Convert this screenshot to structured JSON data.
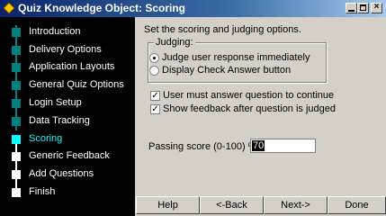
{
  "window": {
    "title": "Quiz Knowledge Object: Scoring"
  },
  "sidebar": {
    "items": [
      {
        "label": "Introduction",
        "state": "done"
      },
      {
        "label": "Delivery Options",
        "state": "done"
      },
      {
        "label": "Application Layouts",
        "state": "done"
      },
      {
        "label": "General Quiz Options",
        "state": "done"
      },
      {
        "label": "Login Setup",
        "state": "done"
      },
      {
        "label": "Data Tracking",
        "state": "done"
      },
      {
        "label": "Scoring",
        "state": "current"
      },
      {
        "label": "Generic Feedback",
        "state": "todo"
      },
      {
        "label": "Add Questions",
        "state": "todo"
      },
      {
        "label": "Finish",
        "state": "todo"
      }
    ]
  },
  "main": {
    "intro": "Set the scoring and judging options.",
    "judging": {
      "legend": "Judging:",
      "option_immediate": "Judge user response immediately",
      "option_button": "Display Check Answer button",
      "selected": "immediate"
    },
    "must_answer_label": "User must answer question to continue",
    "show_feedback_label": "Show feedback after question is judged",
    "passing_label": "Passing score (0-100) %:",
    "passing_value": "70"
  },
  "buttons": {
    "help": "Help",
    "back": "<-Back",
    "next": "Next->",
    "done": "Done"
  },
  "colors": {
    "done_step": "#008080",
    "current_step": "#00ffff",
    "todo_step": "#ffffff"
  }
}
